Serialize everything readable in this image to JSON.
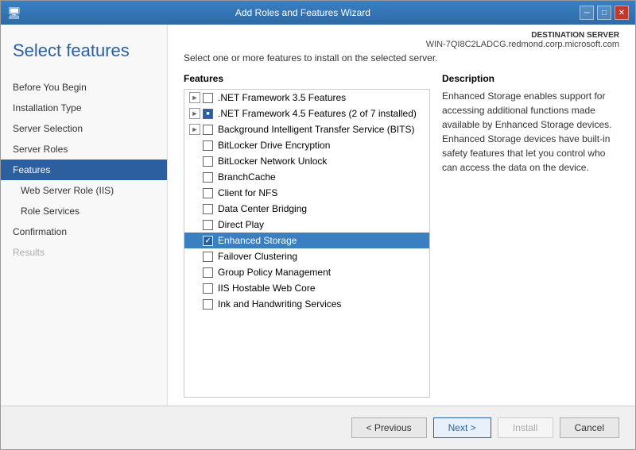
{
  "window": {
    "title": "Add Roles and Features Wizard",
    "icon": "wizard-icon"
  },
  "titlebar": {
    "controls": {
      "minimize": "─",
      "maximize": "□",
      "close": "✕"
    }
  },
  "sidebar": {
    "header": "Select features",
    "items": [
      {
        "id": "before-you-begin",
        "label": "Before You Begin",
        "state": "normal"
      },
      {
        "id": "installation-type",
        "label": "Installation Type",
        "state": "normal"
      },
      {
        "id": "server-selection",
        "label": "Server Selection",
        "state": "normal"
      },
      {
        "id": "server-roles",
        "label": "Server Roles",
        "state": "normal"
      },
      {
        "id": "features",
        "label": "Features",
        "state": "active"
      },
      {
        "id": "web-server-role",
        "label": "Web Server Role (IIS)",
        "state": "normal",
        "indented": true
      },
      {
        "id": "role-services",
        "label": "Role Services",
        "state": "normal",
        "indented": true
      },
      {
        "id": "confirmation",
        "label": "Confirmation",
        "state": "normal"
      },
      {
        "id": "results",
        "label": "Results",
        "state": "disabled"
      }
    ]
  },
  "destination_server": {
    "label": "DESTINATION SERVER",
    "name": "WIN-7QI8C2LADCG.redmond.corp.microsoft.com"
  },
  "main": {
    "instruction": "Select one or more features to install on the selected server.",
    "features_label": "Features",
    "description_label": "Description",
    "description_text": "Enhanced Storage enables support for accessing additional functions made available by Enhanced Storage devices. Enhanced Storage devices have built-in safety features that let you control who can access the data on the device.",
    "features": [
      {
        "id": "net35",
        "label": ".NET Framework 3.5 Features",
        "checkbox": "none",
        "expand": "►",
        "indent": 0
      },
      {
        "id": "net45",
        "label": ".NET Framework 4.5 Features (2 of 7 installed)",
        "checkbox": "partial",
        "expand": "►",
        "indent": 0
      },
      {
        "id": "bits",
        "label": "Background Intelligent Transfer Service (BITS)",
        "checkbox": "none",
        "expand": "►",
        "indent": 0
      },
      {
        "id": "bitlocker",
        "label": "BitLocker Drive Encryption",
        "checkbox": "none",
        "expand": "",
        "indent": 0
      },
      {
        "id": "bitlocker-network",
        "label": "BitLocker Network Unlock",
        "checkbox": "none",
        "expand": "",
        "indent": 0
      },
      {
        "id": "branchcache",
        "label": "BranchCache",
        "checkbox": "none",
        "expand": "",
        "indent": 0
      },
      {
        "id": "client-nfs",
        "label": "Client for NFS",
        "checkbox": "none",
        "expand": "",
        "indent": 0
      },
      {
        "id": "dcb",
        "label": "Data Center Bridging",
        "checkbox": "none",
        "expand": "",
        "indent": 0
      },
      {
        "id": "direct-play",
        "label": "Direct Play",
        "checkbox": "none",
        "expand": "",
        "indent": 0
      },
      {
        "id": "enhanced-storage",
        "label": "Enhanced Storage",
        "checkbox": "checked",
        "expand": "",
        "indent": 0,
        "selected": true
      },
      {
        "id": "failover-clustering",
        "label": "Failover Clustering",
        "checkbox": "none",
        "expand": "",
        "indent": 0
      },
      {
        "id": "group-policy",
        "label": "Group Policy Management",
        "checkbox": "none",
        "expand": "",
        "indent": 0
      },
      {
        "id": "iis-hostable",
        "label": "IIS Hostable Web Core",
        "checkbox": "none",
        "expand": "",
        "indent": 0
      },
      {
        "id": "ink-handwriting",
        "label": "Ink and Handwriting Services",
        "checkbox": "none",
        "expand": "",
        "indent": 0
      }
    ]
  },
  "footer": {
    "previous_label": "< Previous",
    "next_label": "Next >",
    "install_label": "Install",
    "cancel_label": "Cancel"
  }
}
